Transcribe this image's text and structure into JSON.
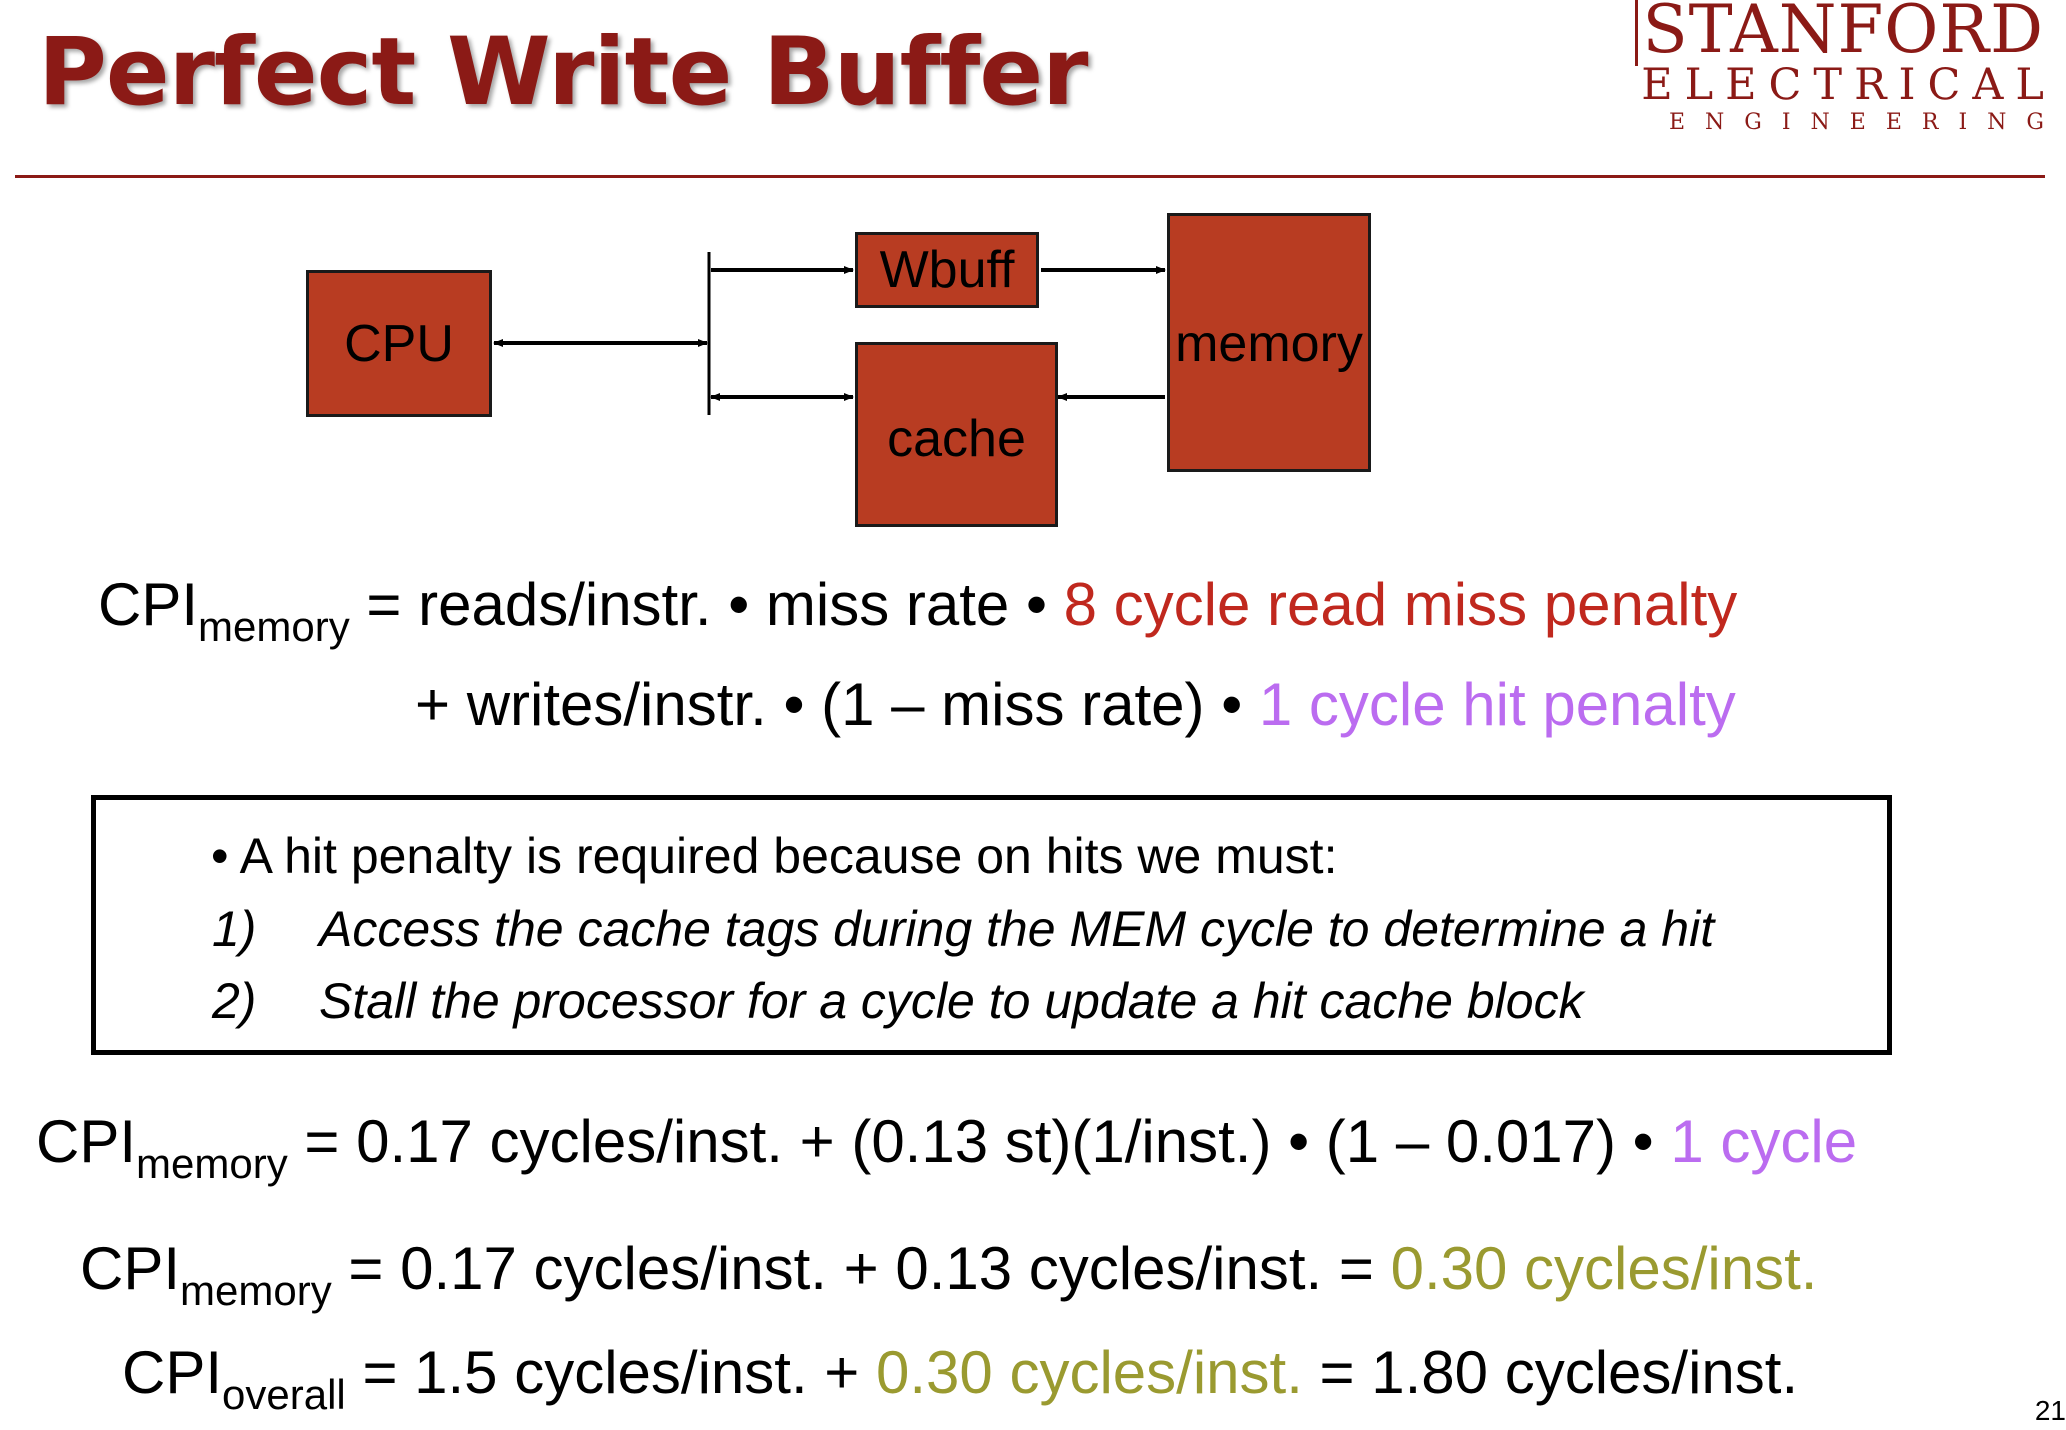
{
  "title": "Perfect Write Buffer",
  "logo": {
    "line1": "STANFORD",
    "line2": "ELECTRICAL",
    "line3": "ENGINEERING"
  },
  "diagram": {
    "cpu": "CPU",
    "wbuff": "Wbuff",
    "cache": "cache",
    "memory": "memory"
  },
  "formula1": {
    "lhs": "CPI",
    "lhs_sub": "memory",
    "part1": "= reads/instr. • miss rate • ",
    "part1_red": "8 cycle read miss penalty",
    "part2": "+ writes/instr. • (1 – miss rate) • ",
    "part2_purple": "1 cycle hit penalty"
  },
  "box": {
    "intro": "• A hit penalty is required because on hits we must:",
    "items": [
      {
        "num": "1)",
        "text": "Access the cache tags during the MEM cycle to determine a hit"
      },
      {
        "num": "2)",
        "text": "Stall the processor for a cycle to update a hit cache block"
      }
    ]
  },
  "formula2": {
    "lhs": "CPI",
    "lhs_sub": "memory",
    "text": "= 0.17 cycles/inst. + (0.13 st)(1/inst.) • (1 – 0.017) • ",
    "purple": "1 cycle"
  },
  "formula3": {
    "lhs": "CPI",
    "lhs_sub": "memory",
    "text": "= 0.17 cycles/inst. + 0.13 cycles/inst. = ",
    "olive": "0.30 cycles/inst."
  },
  "formula4": {
    "lhs": "CPI",
    "lhs_sub": "overall",
    "text1": "= 1.5 cycles/inst. + ",
    "olive": "0.30 cycles/inst.",
    "text2": " = 1.80 cycles/inst."
  },
  "page_number": "21",
  "colors": {
    "title": "#8b1a16",
    "block_fill": "#b83c22",
    "red_text": "#c0281e",
    "purple_text": "#bb6cf0",
    "olive_text": "#9a9a30"
  }
}
